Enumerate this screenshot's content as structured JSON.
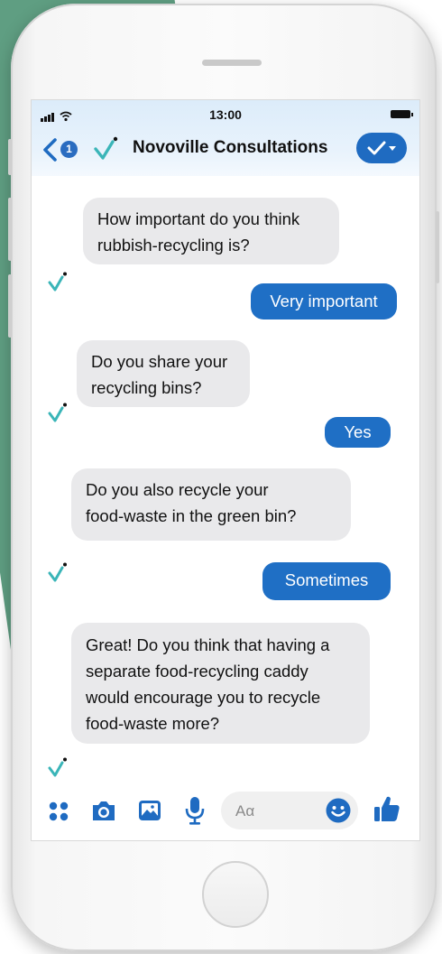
{
  "status_bar": {
    "time": "13:00"
  },
  "header": {
    "back_badge": "1",
    "title": "Novoville Consultations"
  },
  "messages": [
    {
      "from": "bot",
      "lines": [
        "How important do you think",
        "rubbish-recycling is?"
      ]
    },
    {
      "from": "user",
      "text": "Very important"
    },
    {
      "from": "bot",
      "lines": [
        "Do you share your",
        "recycling bins?"
      ]
    },
    {
      "from": "user",
      "text": "Yes"
    },
    {
      "from": "bot",
      "lines": [
        "Do you also recycle your",
        "food-waste in the green bin?"
      ]
    },
    {
      "from": "user",
      "text": "Sometimes"
    },
    {
      "from": "bot",
      "lines": [
        "Great! Do you think that having a",
        "separate food-recycling caddy",
        "would encourage you to recycle",
        "food-waste more?"
      ]
    }
  ],
  "composer": {
    "placeholder": "Aα"
  },
  "toolbar": {
    "icons": [
      "apps-icon",
      "camera-icon",
      "gallery-icon",
      "microphone-icon",
      "emoji-icon",
      "thumbs-up-icon"
    ]
  },
  "colors": {
    "accent": "#1f6fc5",
    "bot_bubble": "#e9e9eb",
    "check_teal": "#3ab5b8",
    "background_green": "#5f9e82"
  }
}
